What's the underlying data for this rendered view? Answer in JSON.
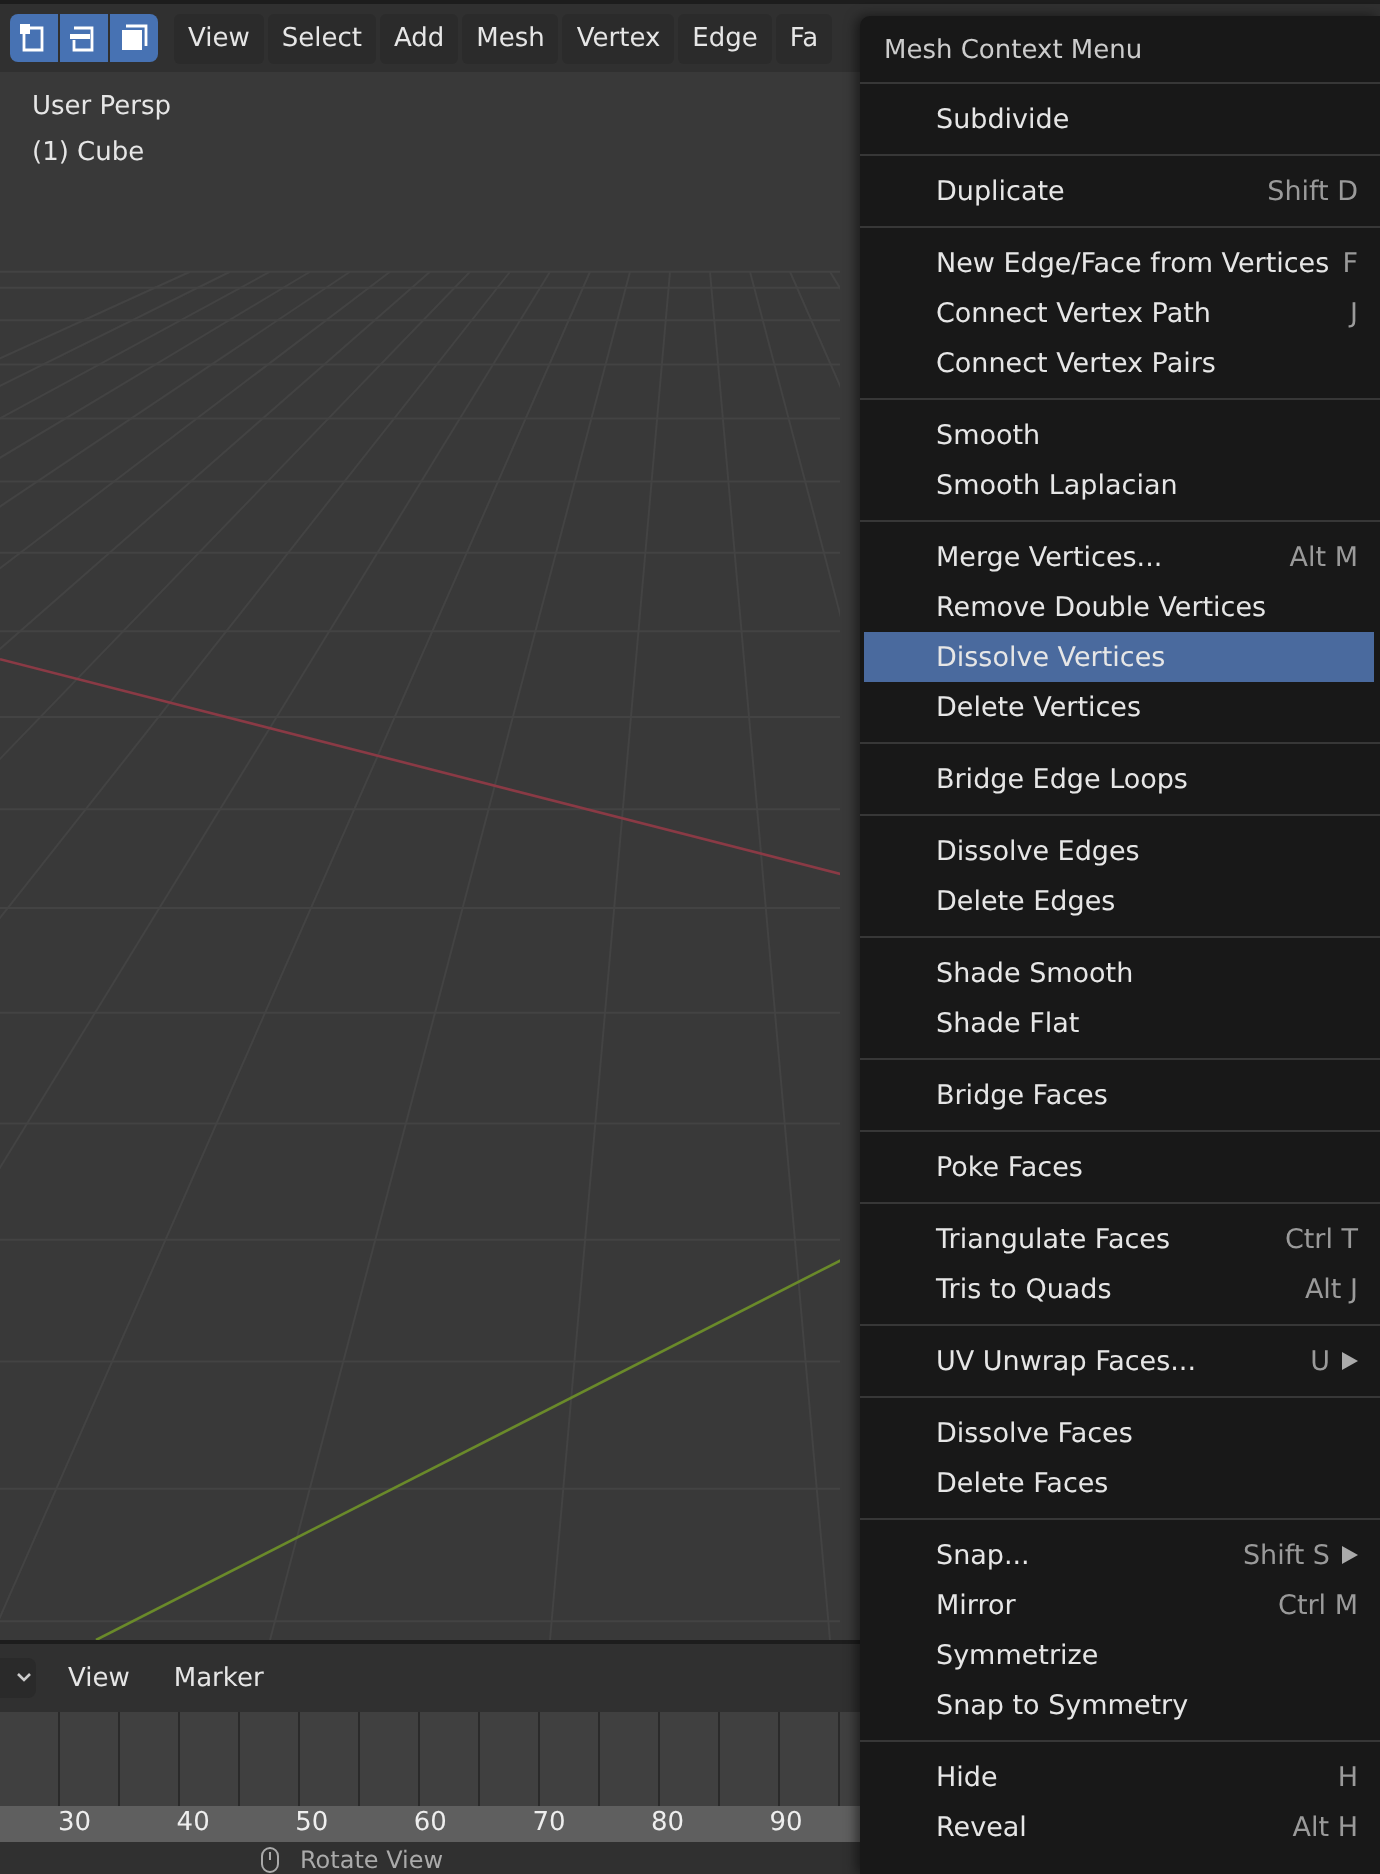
{
  "header": {
    "mode_buttons": [
      {
        "kind": "vertex",
        "selected": true
      },
      {
        "kind": "edge",
        "selected": true
      },
      {
        "kind": "face",
        "selected": true
      }
    ],
    "menus": [
      "View",
      "Select",
      "Add",
      "Mesh",
      "Vertex",
      "Edge",
      "Fa"
    ]
  },
  "viewport": {
    "overlay_lines": [
      "User Persp",
      "(1) Cube"
    ]
  },
  "timeline": {
    "menus": [
      "View",
      "Marker"
    ],
    "ticks": [
      "30",
      "40",
      "50",
      "60",
      "70",
      "80",
      "90"
    ]
  },
  "status_bar": {
    "hint": "Rotate View"
  },
  "context_menu": {
    "title": "Mesh Context Menu",
    "sections": [
      [
        {
          "label": "Subdivide",
          "submenu": false,
          "selected": false
        }
      ],
      [
        {
          "label": "Duplicate",
          "shortcut": "Shift D",
          "submenu": false,
          "selected": false
        }
      ],
      [
        {
          "label": "New Edge/Face from Vertices",
          "shortcut": "F",
          "submenu": false,
          "selected": false
        },
        {
          "label": "Connect Vertex Path",
          "shortcut": "J",
          "submenu": false,
          "selected": false
        },
        {
          "label": "Connect Vertex Pairs",
          "submenu": false,
          "selected": false
        }
      ],
      [
        {
          "label": "Smooth",
          "submenu": false,
          "selected": false
        },
        {
          "label": "Smooth Laplacian",
          "submenu": false,
          "selected": false
        }
      ],
      [
        {
          "label": "Merge Vertices...",
          "shortcut": "Alt M",
          "submenu": false,
          "selected": false
        },
        {
          "label": "Remove Double Vertices",
          "submenu": false,
          "selected": false
        },
        {
          "label": "Dissolve Vertices",
          "submenu": false,
          "selected": true
        },
        {
          "label": "Delete Vertices",
          "submenu": false,
          "selected": false
        }
      ],
      [
        {
          "label": "Bridge Edge Loops",
          "submenu": false,
          "selected": false
        }
      ],
      [
        {
          "label": "Dissolve Edges",
          "submenu": false,
          "selected": false
        },
        {
          "label": "Delete Edges",
          "submenu": false,
          "selected": false
        }
      ],
      [
        {
          "label": "Shade Smooth",
          "submenu": false,
          "selected": false
        },
        {
          "label": "Shade Flat",
          "submenu": false,
          "selected": false
        }
      ],
      [
        {
          "label": "Bridge Faces",
          "submenu": false,
          "selected": false
        }
      ],
      [
        {
          "label": "Poke Faces",
          "submenu": false,
          "selected": false
        }
      ],
      [
        {
          "label": "Triangulate Faces",
          "shortcut": "Ctrl T",
          "submenu": false,
          "selected": false
        },
        {
          "label": "Tris to Quads",
          "shortcut": "Alt J",
          "submenu": false,
          "selected": false
        }
      ],
      [
        {
          "label": "UV Unwrap Faces...",
          "shortcut": "U",
          "submenu": true,
          "selected": false
        }
      ],
      [
        {
          "label": "Dissolve Faces",
          "submenu": false,
          "selected": false
        },
        {
          "label": "Delete Faces",
          "submenu": false,
          "selected": false
        }
      ],
      [
        {
          "label": "Snap...",
          "shortcut": "Shift S",
          "submenu": true,
          "selected": false
        },
        {
          "label": "Mirror",
          "shortcut": "Ctrl M",
          "submenu": false,
          "selected": false
        },
        {
          "label": "Symmetrize",
          "submenu": false,
          "selected": false
        },
        {
          "label": "Snap to Symmetry",
          "submenu": false,
          "selected": false
        }
      ],
      [
        {
          "label": "Hide",
          "shortcut": "H",
          "submenu": false,
          "selected": false
        },
        {
          "label": "Reveal",
          "shortcut": "Alt H",
          "submenu": false,
          "selected": false
        }
      ]
    ]
  }
}
